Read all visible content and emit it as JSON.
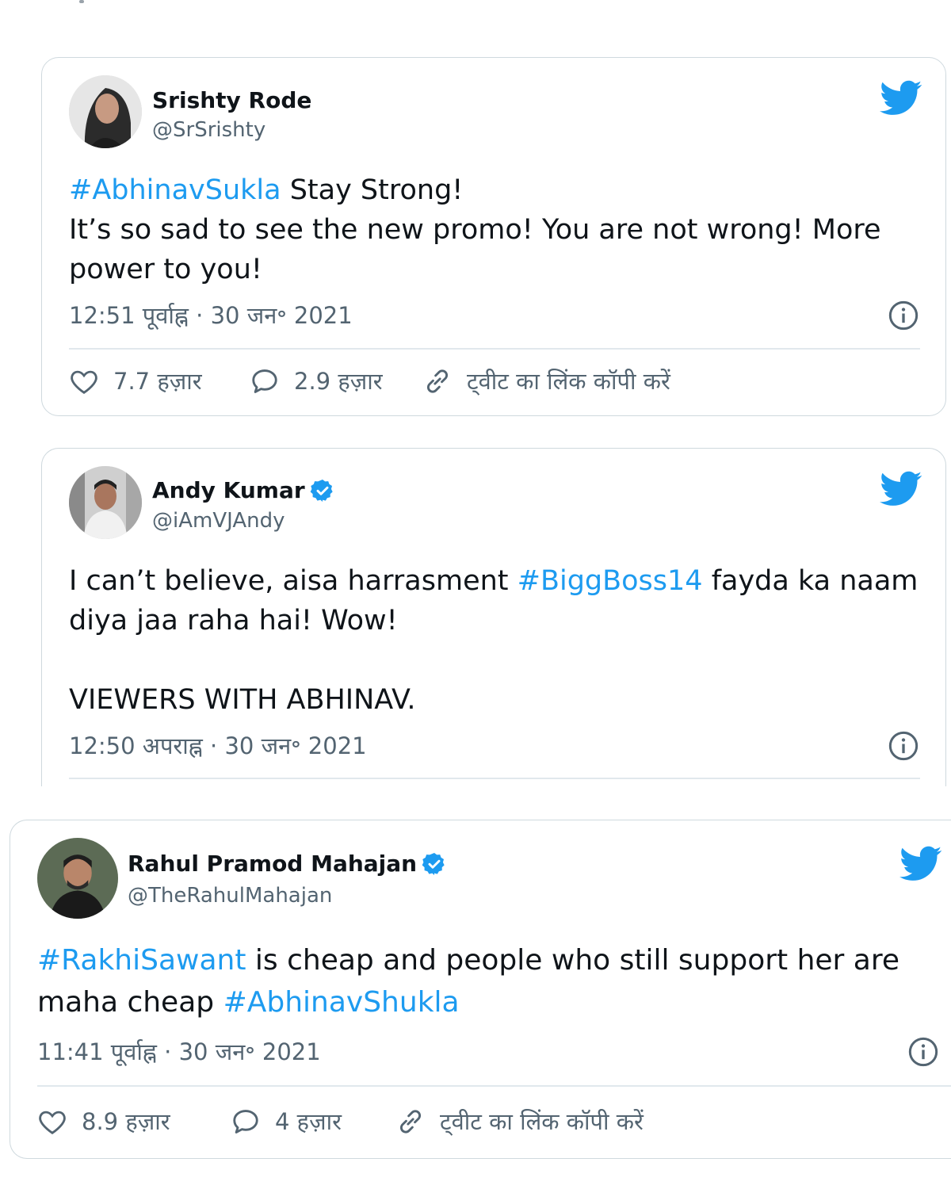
{
  "tweets": [
    {
      "name": "Srishty Rode",
      "handle": "@SrSrishty",
      "verified": false,
      "lines": [
        [
          {
            "t": "#AbhinavSukla",
            "tag": true
          },
          {
            "t": " Stay Strong!"
          }
        ],
        [
          {
            "t": "It’s so sad to see the new promo! You are not wrong! More"
          }
        ],
        [
          {
            "t": "power to you!"
          }
        ]
      ],
      "time": "12:51 पूर्वाह्न · 30 जन॰ 2021",
      "likes": "7.7 हज़ार",
      "replies": "2.9 हज़ार",
      "copy_link": "ट्वीट का लिंक कॉपी करें"
    },
    {
      "name": "Andy Kumar",
      "handle": "@iAmVJAndy",
      "verified": true,
      "lines": [
        [
          {
            "t": "I can’t believe, aisa harrasment "
          },
          {
            "t": "#BiggBoss14",
            "tag": true
          },
          {
            "t": " fayda ka naam"
          }
        ],
        [
          {
            "t": "diya jaa raha hai! Wow!"
          }
        ],
        [
          {
            "t": ""
          }
        ],
        [
          {
            "t": "VIEWERS WITH ABHINAV."
          }
        ]
      ],
      "time": "12:50 अपराह्न · 30 जन॰ 2021"
    },
    {
      "name": "Rahul Pramod Mahajan",
      "handle": "@TheRahulMahajan",
      "verified": true,
      "lines": [
        [
          {
            "t": "#RakhiSawant",
            "tag": true
          },
          {
            "t": " is cheap and people who still support her are"
          }
        ],
        [
          {
            "t": "maha cheap "
          },
          {
            "t": "#AbhinavShukla",
            "tag": true
          }
        ]
      ],
      "time": "11:41 पूर्वाह्न · 30 जन॰ 2021",
      "likes": "8.9 हज़ार",
      "replies": "4 हज़ार",
      "copy_link": "ट्वीट का लिंक कॉपी करें"
    }
  ],
  "icons": {
    "brand": "twitter-bird-icon",
    "verified": "verified-badge-icon",
    "info": "info-icon",
    "like": "heart-icon",
    "reply": "reply-bubble-icon",
    "link": "link-icon"
  },
  "colors": {
    "hashtag": "#1d9bf0",
    "twitter_blue": "#1d9bf0",
    "muted": "#536471",
    "border": "#cfd9de"
  }
}
